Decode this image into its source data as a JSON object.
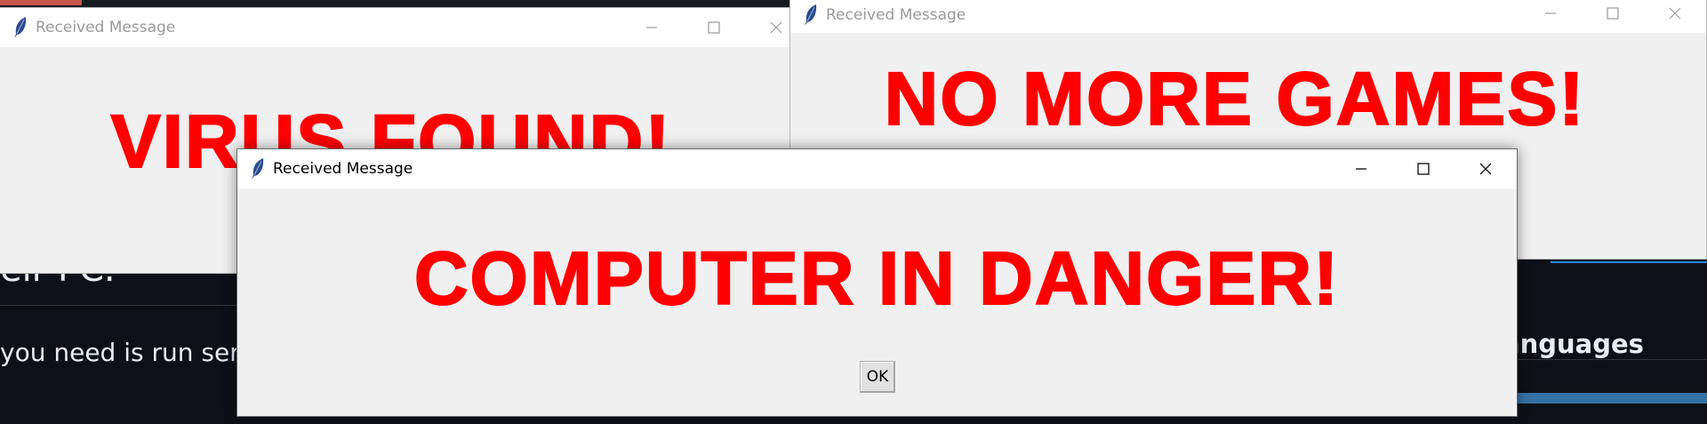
{
  "background_page": {
    "heading": "eir PC.",
    "body_text": "you need is run serv",
    "sidebar_heading": "anguages"
  },
  "windows": [
    {
      "id": "virus",
      "title": "Received Message",
      "message": "VIRUS FOUND!",
      "state": "inactive"
    },
    {
      "id": "games",
      "title": "Received Message",
      "message": "NO MORE GAMES!",
      "state": "inactive"
    },
    {
      "id": "danger",
      "title": "Received Message",
      "message": "COMPUTER IN DANGER!",
      "ok_label": "OK",
      "state": "active"
    }
  ],
  "colors": {
    "message_text": "#ff0000",
    "window_body": "#f0f0f0",
    "titlebar": "#ffffff",
    "page_background": "#0d1117"
  },
  "icons": {
    "window_icon": "feather-icon",
    "minimize": "minimize-icon",
    "maximize": "maximize-icon",
    "close": "close-icon"
  }
}
